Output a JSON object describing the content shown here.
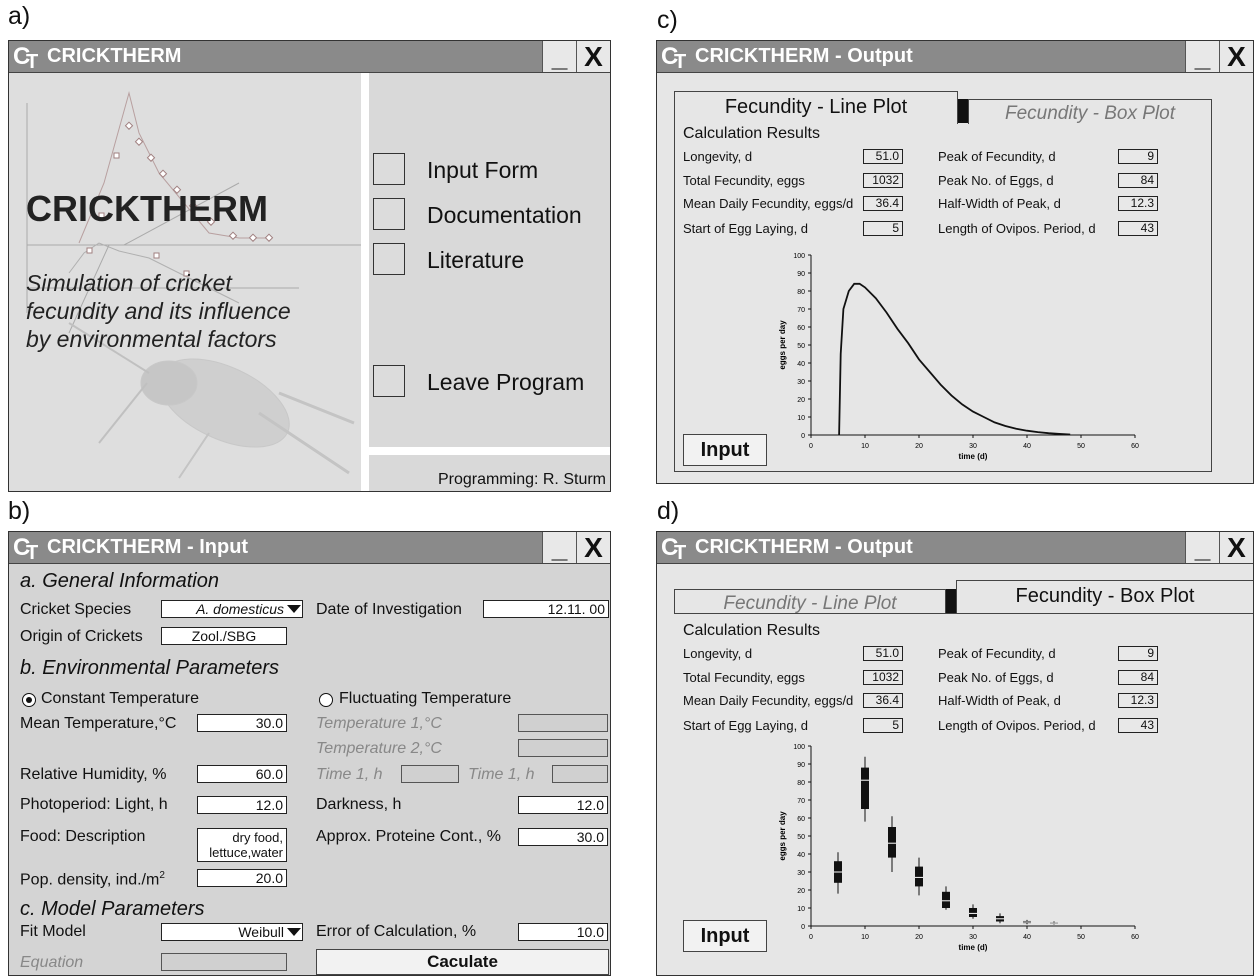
{
  "panel_labels": {
    "a": "a)",
    "b": "b)",
    "c": "c)",
    "d": "d)"
  },
  "window_controls": {
    "minimize": "_",
    "close": "X"
  },
  "logo": {
    "c": "C",
    "t": "T"
  },
  "splash": {
    "title": "CRICKTHERM",
    "big_title": "CRICKTHERM",
    "subtitle_lines": [
      "Simulation of cricket",
      "fecundity and its influence",
      "by environmental factors"
    ],
    "menu": [
      "Input Form",
      "Documentation",
      "Literature",
      "Leave Program"
    ],
    "credit": "Programming: R. Sturm"
  },
  "input": {
    "title": "CRICKTHERM - Input",
    "sec_general": "a. General Information",
    "species_label": "Cricket Species",
    "species_value": "A. domesticus",
    "date_label": "Date of Investigation",
    "date_value": "12.11. 00",
    "origin_label": "Origin of Crickets",
    "origin_value": "Zool./SBG",
    "sec_env": "b. Environmental Parameters",
    "const_temp": "Constant Temperature",
    "fluct_temp": "Fluctuating Temperature",
    "mean_temp_label": "Mean Temperature,°C",
    "mean_temp_value": "30.0",
    "temp1_label": "Temperature 1,°C",
    "temp2_label": "Temperature 2,°C",
    "rh_label": "Relative Humidity, %",
    "rh_value": "60.0",
    "time1a_label": "Time 1, h",
    "time1b_label": "Time 1, h",
    "photo_label": "Photoperiod: Light, h",
    "photo_value": "12.0",
    "dark_label": "Darkness, h",
    "dark_value": "12.0",
    "food_label": "Food: Description",
    "food_value_l1": "dry food,",
    "food_value_l2": "lettuce,water",
    "protein_label": "Approx. Proteine Cont., %",
    "protein_value": "30.0",
    "popd_label": "Pop. density, ind./m",
    "popd_sup": "2",
    "popd_value": "20.0",
    "sec_model": "c. Model Parameters",
    "fit_label": "Fit Model",
    "fit_value": "Weibull",
    "err_label": "Error of Calculation, %",
    "err_value": "10.0",
    "eq_label": "Equation",
    "calc_button": "Caculate"
  },
  "output": {
    "title": "CRICKTHERM - Output",
    "tab_line": "Fecundity - Line Plot",
    "tab_box": "Fecundity - Box Plot",
    "results_title": "Calculation Results",
    "results_left": [
      {
        "label": "Longevity, d",
        "value": "51.0"
      },
      {
        "label": "Total Fecundity, eggs",
        "value": "1032"
      },
      {
        "label": "Mean Daily Fecundity, eggs/d",
        "value": "36.4"
      },
      {
        "label": "Start of Egg Laying, d",
        "value": "5"
      }
    ],
    "results_right": [
      {
        "label": "Peak of Fecundity, d",
        "value": "9"
      },
      {
        "label": "Peak No. of Eggs, d",
        "value": "84"
      },
      {
        "label": "Half-Width of Peak, d",
        "value": "12.3"
      },
      {
        "label": "Length of Ovipos. Period, d",
        "value": "43"
      }
    ],
    "input_button": "Input"
  },
  "chart_data": [
    {
      "type": "line",
      "xlabel": "time (d)",
      "ylabel": "eggs per day",
      "xlim": [
        0,
        60
      ],
      "ylim": [
        0,
        100
      ],
      "x_ticks": [
        "0",
        "10",
        "20",
        "30",
        "40",
        "50",
        "60"
      ],
      "y_ticks": [
        "0",
        "10",
        "20",
        "30",
        "40",
        "50",
        "60",
        "70",
        "80",
        "90",
        "100"
      ],
      "x": [
        5.2,
        5.5,
        6,
        7,
        8,
        9,
        10,
        12,
        14,
        16,
        18,
        20,
        22,
        24,
        26,
        28,
        30,
        32,
        34,
        36,
        38,
        40,
        42,
        44,
        46,
        48
      ],
      "y": [
        0,
        45,
        70,
        80,
        84,
        84,
        82,
        76,
        68,
        59,
        51,
        42,
        35,
        28,
        22,
        17,
        13,
        10,
        7,
        5,
        3.5,
        2.4,
        1.6,
        1,
        0.6,
        0.3
      ]
    },
    {
      "type": "box",
      "xlabel": "time (d)",
      "ylabel": "eggs per day",
      "xlim": [
        0,
        60
      ],
      "ylim": [
        0,
        100
      ],
      "x_ticks": [
        "0",
        "10",
        "20",
        "30",
        "40",
        "50",
        "60"
      ],
      "y_ticks": [
        "0",
        "10",
        "20",
        "30",
        "40",
        "50",
        "60",
        "70",
        "80",
        "90",
        "100"
      ],
      "boxes": [
        {
          "x": 5,
          "min": 18,
          "q1": 24,
          "median": 30,
          "q3": 36,
          "max": 41
        },
        {
          "x": 10,
          "min": 58,
          "q1": 65,
          "median": 81,
          "q3": 88,
          "max": 94
        },
        {
          "x": 15,
          "min": 30,
          "q1": 38,
          "median": 46,
          "q3": 55,
          "max": 61
        },
        {
          "x": 20,
          "min": 17,
          "q1": 22,
          "median": 27,
          "q3": 33,
          "max": 38
        },
        {
          "x": 25,
          "min": 9,
          "q1": 10,
          "median": 14,
          "q3": 19,
          "max": 22
        },
        {
          "x": 30,
          "min": 4,
          "q1": 5,
          "median": 7,
          "q3": 10,
          "max": 12
        },
        {
          "x": 35,
          "min": 1.5,
          "q1": 2.5,
          "median": 4,
          "q3": 5.5,
          "max": 7
        },
        {
          "x": 40,
          "min": 1,
          "q1": 1.6,
          "median": 2.2,
          "q3": 2.8,
          "max": 3.4
        },
        {
          "x": 45,
          "min": 0.8,
          "q1": 1.2,
          "median": 1.6,
          "q3": 2,
          "max": 2.6
        }
      ]
    }
  ]
}
